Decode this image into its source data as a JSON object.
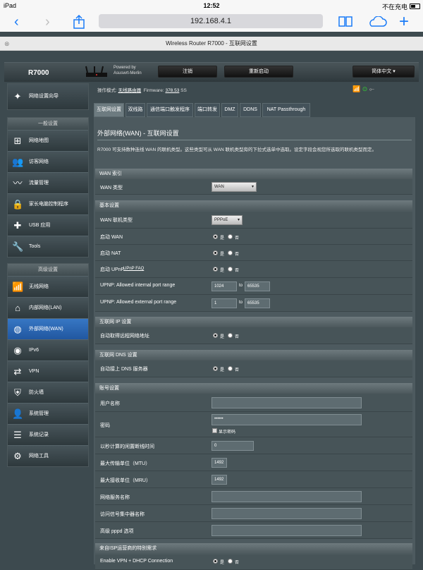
{
  "status": {
    "device": "iPad",
    "time": "12:52",
    "charge": "不在充电"
  },
  "browser": {
    "address": "192.168.4.1",
    "page_title": "Wireless Router R7000 - 互联网设置",
    "back": "‹",
    "forward": "›"
  },
  "router": {
    "model": "R7000",
    "powered_by": "Powered by",
    "firmware_by": "Asuswrt-Merlin",
    "logout": "注销",
    "reboot": "重新启动",
    "language": "简体中文",
    "op_mode_label": "操作模式:",
    "op_mode": "无线路由器",
    "fw_label": "Firmware:",
    "fw_version": "378.53",
    "fw_more": "SS"
  },
  "sidebar": {
    "quick": "网络设置向导",
    "general_title": "一般设置",
    "general": [
      "网络地图",
      "访客网络",
      "流量管理",
      "家长电脑控制程序",
      "USB 应用",
      "Tools"
    ],
    "advanced_title": "高级设置",
    "advanced": [
      "无线网络",
      "内部网络(LAN)",
      "外部网络(WAN)",
      "IPv6",
      "VPN",
      "防火墙",
      "系统管理",
      "系统记录",
      "网络工具"
    ]
  },
  "tabs": [
    "互联网设置",
    "双线路",
    "通信端口触发程序",
    "端口转发",
    "DMZ",
    "DDNS",
    "NAT Passthrough"
  ],
  "page": {
    "heading": "外部网络(WAN) - 互联网设置",
    "desc": "R7000 可支持数种连线 WAN 的联机类型。这些类型可从 WAN 联机类型旁的下拉式选单中选取。设定字段会视您所选取的联机类型而定。"
  },
  "sec_index": {
    "title": "WAN 索引",
    "wan_type_label": "WAN 类型",
    "wan_type": "WAN"
  },
  "sec_basic": {
    "title": "基本设置",
    "conn_type_label": "WAN 联机类型",
    "conn_type": "PPPoE",
    "enable_wan": "启动 WAN",
    "enable_nat": "启动 NAT",
    "enable_upnp": "启动 UPnP",
    "upnp_faq": "UPnP FAQ",
    "yes": "是",
    "no": "否",
    "upnp_int_label": "UPNP: Allowed internal port range",
    "upnp_int_from": "1024",
    "upnp_int_to": "65535",
    "to": "to",
    "upnp_ext_label": "UPNP: Allowed external port range",
    "upnp_ext_from": "1",
    "upnp_ext_to": "65535"
  },
  "sec_ip": {
    "title": "互联网 IP 设置",
    "auto_ip": "自动取得远程网络地址"
  },
  "sec_dns": {
    "title": "互联网 DNS 设置",
    "auto_dns": "自动接上 DNS 服务器"
  },
  "sec_account": {
    "title": "账号设置",
    "username": "用户名称",
    "password": "密码",
    "password_val": "••••••",
    "show_pw": "显示密码",
    "idle": "以秒计算的闲置断线时间",
    "idle_val": "0",
    "mtu": "最大传输单位（MTU）",
    "mtu_val": "1492",
    "mru": "最大接收单位（MRU）",
    "mru_val": "1492",
    "svc": "网络服务名称",
    "ac": "访问信号集中器名称",
    "pppd": "高级 pppd 选项"
  },
  "sec_isp": {
    "title": "来自ISP运营商的特别需求",
    "vpn_dhcp": "Enable VPN + DHCP Connection"
  }
}
